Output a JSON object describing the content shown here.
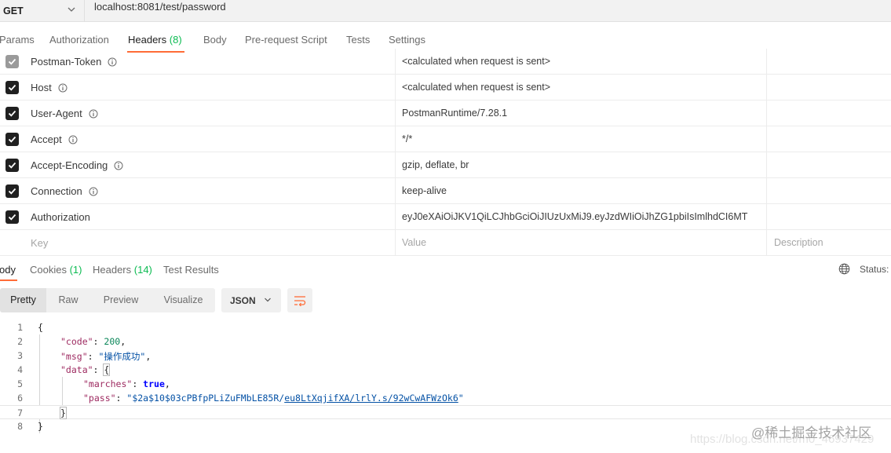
{
  "request": {
    "method": "GET",
    "url": "localhost:8081/test/password"
  },
  "request_tabs": [
    {
      "label": "Params"
    },
    {
      "label": "Authorization"
    },
    {
      "label": "Headers",
      "count": "(8)"
    },
    {
      "label": "Body"
    },
    {
      "label": "Pre-request Script"
    },
    {
      "label": "Tests"
    },
    {
      "label": "Settings"
    }
  ],
  "headers": [
    {
      "key": "Postman-Token",
      "value": "<calculated when request is sent>",
      "checked": true,
      "disabled": true
    },
    {
      "key": "Host",
      "value": "<calculated when request is sent>",
      "checked": true
    },
    {
      "key": "User-Agent",
      "value": "PostmanRuntime/7.28.1",
      "checked": true
    },
    {
      "key": "Accept",
      "value": "*/*",
      "checked": true
    },
    {
      "key": "Accept-Encoding",
      "value": "gzip, deflate, br",
      "checked": true
    },
    {
      "key": "Connection",
      "value": "keep-alive",
      "checked": true
    },
    {
      "key": "Authorization",
      "value": "eyJ0eXAiOiJKV1QiLCJhbGciOiJIUzUxMiJ9.eyJzdWIiOiJhZG1pbiIsImlhdCI6MT",
      "checked": true
    }
  ],
  "new_row": {
    "key_placeholder": "Key",
    "value_placeholder": "Value",
    "description_placeholder": "Description"
  },
  "response_tabs": [
    {
      "label": "ody"
    },
    {
      "label": "Cookies",
      "count": "(1)"
    },
    {
      "label": "Headers",
      "count": "(14)"
    },
    {
      "label": "Test Results"
    }
  ],
  "status_label": "Status:",
  "view_modes": [
    "Pretty",
    "Raw",
    "Preview",
    "Visualize"
  ],
  "format": "JSON",
  "code_lines": [
    "1",
    "2",
    "3",
    "4",
    "5",
    "6",
    "7",
    "8"
  ],
  "response_json": {
    "code_key": "\"code\"",
    "code_val": "200",
    "msg_key": "\"msg\"",
    "msg_val": "\"操作成功\"",
    "data_key": "\"data\"",
    "marches_key": "\"marches\"",
    "marches_val": "true",
    "pass_key": "\"pass\"",
    "pass_val_prefix": "\"$2a$10$03cPBfpPLiZuFMbLE85R/",
    "pass_val_link": "eu8LtXqjifXA/lrlY.s/92wCwAFWzOk6",
    "pass_val_suffix": "\""
  },
  "watermark": "@稀土掘金技术社区",
  "watermark_sub": "https://blog.csdn.net/m0_46937429",
  "icons": [
    "chevron-down-icon",
    "info-icon",
    "checkbox-checked-icon",
    "globe-icon",
    "wrap-lines-icon"
  ],
  "colors": {
    "accent": "#ff6c37",
    "count": "#0cbb52",
    "string": "#0451a5",
    "number": "#098658"
  }
}
